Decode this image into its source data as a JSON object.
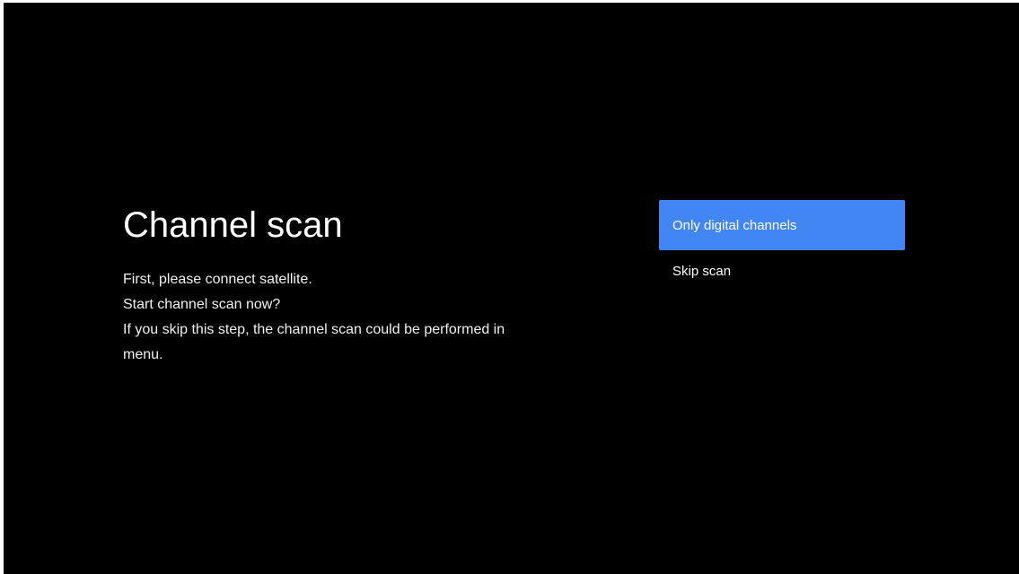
{
  "screen": {
    "title": "Channel scan",
    "description_lines": [
      "First, please connect satellite.",
      "Start channel scan now?",
      "If you skip this step, the channel scan could be performed in",
      "menu."
    ]
  },
  "options": [
    {
      "label": "Only digital channels",
      "selected": true
    },
    {
      "label": "Skip scan",
      "selected": false
    }
  ],
  "colors": {
    "background": "#000000",
    "accent": "#4285f4",
    "text": "#ffffff"
  }
}
